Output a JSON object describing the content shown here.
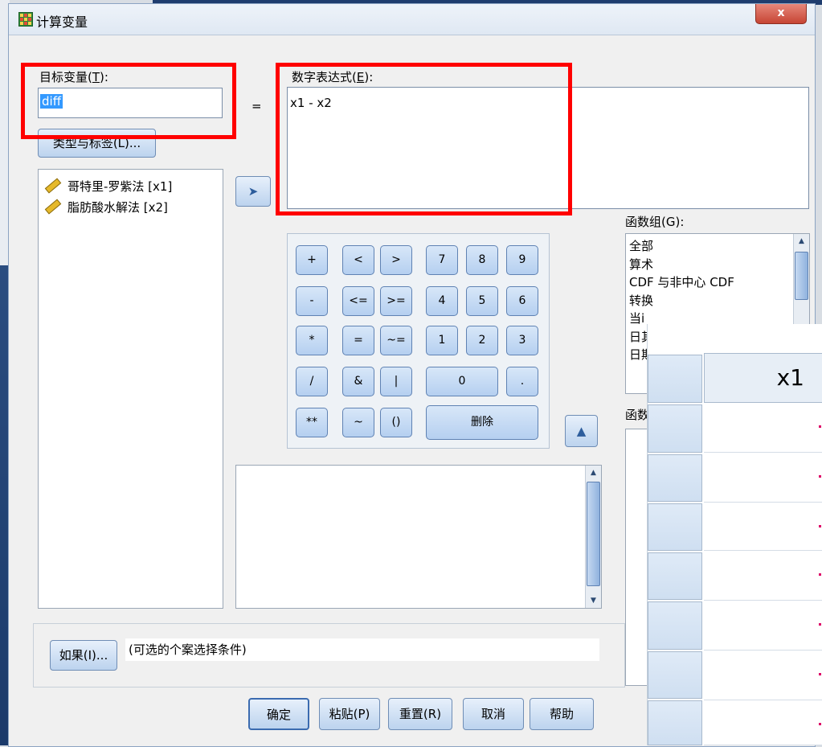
{
  "window": {
    "title": "计算变量",
    "close_label": "x"
  },
  "target": {
    "label": "目标变量(",
    "label_key": "T",
    "label_end": "):",
    "value": "diff",
    "type_label_button": "类型与标签(L)..."
  },
  "equals": "=",
  "expression": {
    "label": "数字表达式(",
    "label_key": "E",
    "label_end": "):",
    "value": "x1 - x2"
  },
  "variables": [
    {
      "label": "哥特里-罗紫法 [x1]"
    },
    {
      "label": "脂肪酸水解法 [x2]"
    }
  ],
  "keypad": [
    [
      "+",
      "<",
      ">",
      "7",
      "8",
      "9"
    ],
    [
      "-",
      "<=",
      ">=",
      "4",
      "5",
      "6"
    ],
    [
      "*",
      "=",
      "~=",
      "1",
      "2",
      "3"
    ],
    [
      "/",
      "&",
      "|",
      "0",
      "."
    ],
    [
      "**",
      "~",
      "()",
      "删除"
    ]
  ],
  "function_group": {
    "label": "函数组(G):",
    "items": [
      "全部",
      "算术",
      "CDF 与非中心 CDF",
      "转换",
      "当i",
      "日其",
      "日期"
    ]
  },
  "functions_label": "函数",
  "if_section": {
    "button": "如果(I)...",
    "condition": "(可选的个案选择条件)"
  },
  "buttons": {
    "ok": "确定",
    "paste": "粘贴(P)",
    "reset": "重置(R)",
    "cancel": "取消",
    "help": "帮助"
  },
  "grid_overlay": {
    "column_header": "x1"
  },
  "colors": {
    "highlight": "#ff0000",
    "selection": "#3399ff"
  }
}
